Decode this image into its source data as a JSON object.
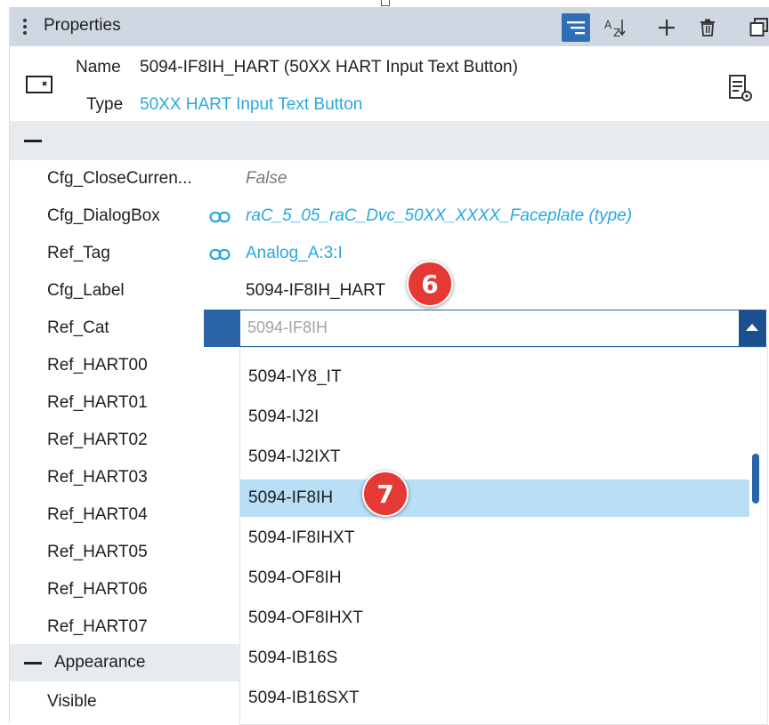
{
  "header": {
    "title": "Properties"
  },
  "object": {
    "name_label": "Name",
    "name_value": "5094-IF8IH_HART (50XX HART Input Text Button)",
    "type_label": "Type",
    "type_value": "50XX HART Input Text Button"
  },
  "properties": [
    {
      "name": "Cfg_CloseCurren...",
      "value": "False"
    },
    {
      "name": "Cfg_DialogBox",
      "value": "raC_5_05_raC_Dvc_50XX_XXXX_Faceplate (type)"
    },
    {
      "name": "Ref_Tag",
      "value": "Analog_A:3:I"
    },
    {
      "name": "Cfg_Label",
      "value": "5094-IF8IH_HART"
    },
    {
      "name": "Ref_Cat",
      "value": ""
    },
    {
      "name": "Ref_HART00"
    },
    {
      "name": "Ref_HART01"
    },
    {
      "name": "Ref_HART02"
    },
    {
      "name": "Ref_HART03"
    },
    {
      "name": "Ref_HART04"
    },
    {
      "name": "Ref_HART05"
    },
    {
      "name": "Ref_HART06"
    },
    {
      "name": "Ref_HART07"
    }
  ],
  "dropdown": {
    "current_value": "5094-IF8IH",
    "options": [
      "5094-IY8_IT",
      "5094-IJ2I",
      "5094-IJ2IXT",
      "5094-IF8IH",
      "5094-IF8IHXT",
      "5094-OF8IH",
      "5094-OF8IHXT",
      "5094-IB16S",
      "5094-IB16SXT"
    ],
    "selected_index": 3
  },
  "appearance": {
    "label": "Appearance",
    "visible_label": "Visible"
  },
  "callouts": [
    "6",
    "7"
  ],
  "colors": {
    "header_bg": "#cfd8e2",
    "accent_blue": "#2f6fb6",
    "link_blue": "#29a8e0",
    "selected_row": "#b8dff5",
    "callout_red": "#e53935"
  }
}
